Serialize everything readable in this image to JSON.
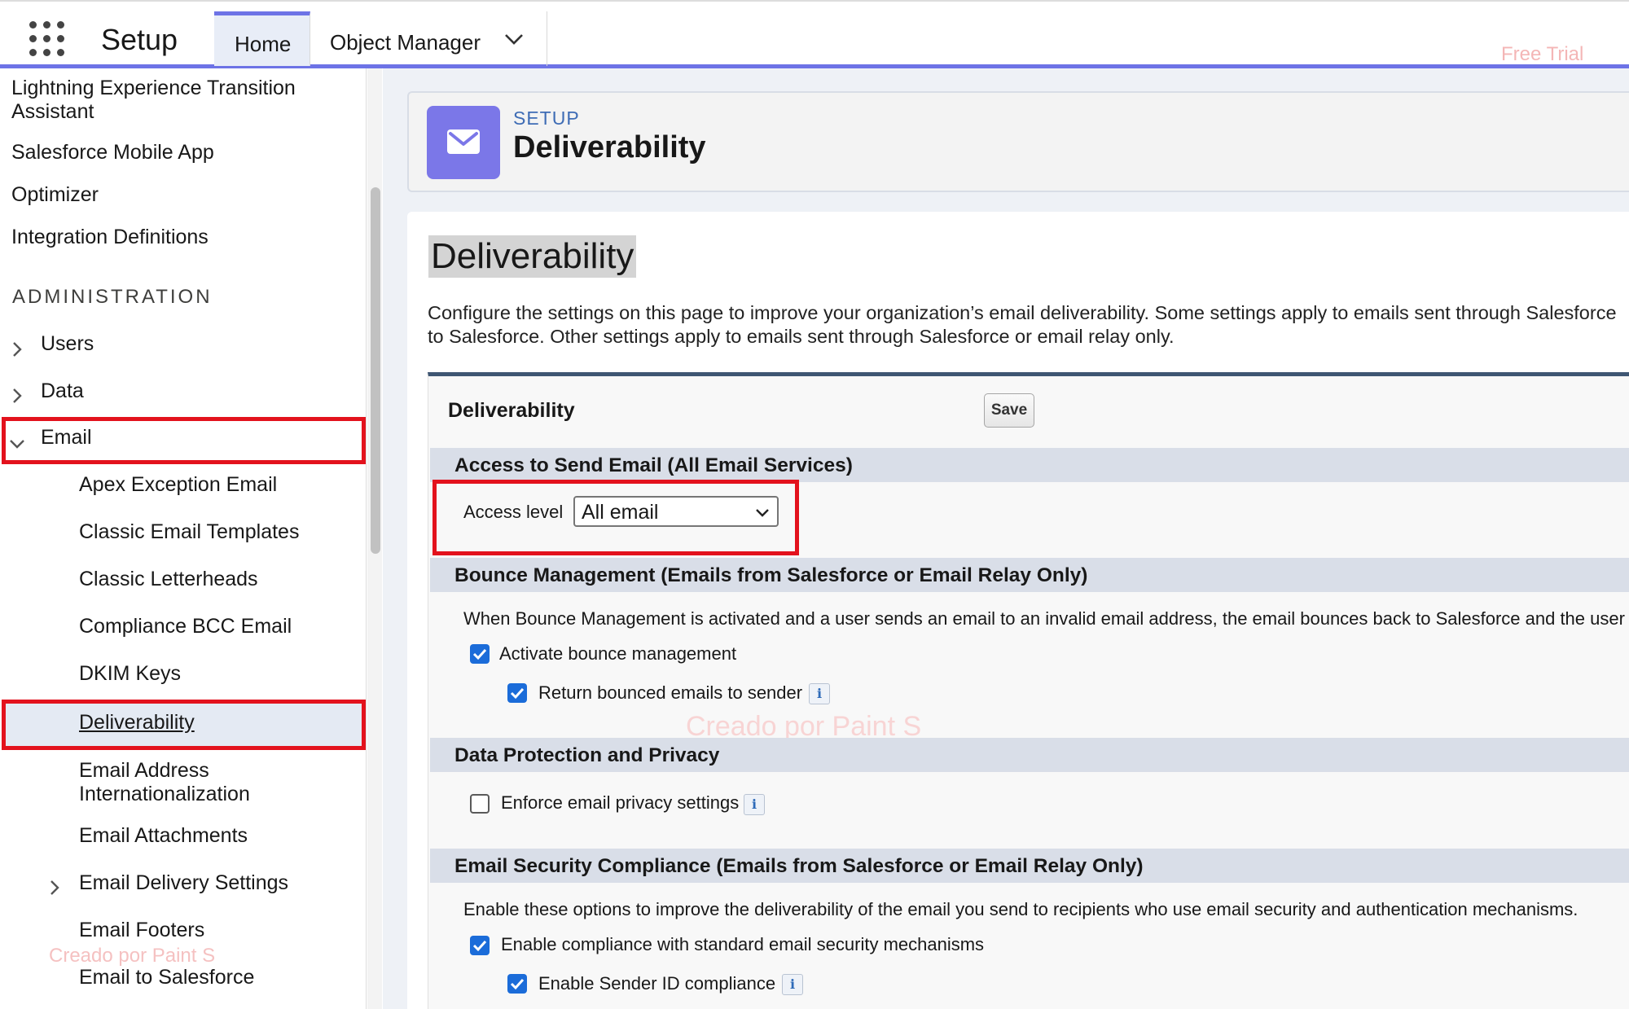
{
  "topbar": {
    "app_title": "Setup",
    "tabs": [
      {
        "label": "Home"
      },
      {
        "label": "Object Manager"
      }
    ],
    "free_trial": "Free Trial"
  },
  "sidebar": {
    "items_top": [
      {
        "label": "Lightning Experience Transition Assistant"
      },
      {
        "label": "Salesforce Mobile App"
      },
      {
        "label": "Optimizer"
      },
      {
        "label": "Integration Definitions"
      }
    ],
    "section_heading": "ADMINISTRATION",
    "groups": [
      {
        "label": "Users"
      },
      {
        "label": "Data"
      },
      {
        "label": "Email"
      }
    ],
    "email_children": [
      {
        "label": "Apex Exception Email"
      },
      {
        "label": "Classic Email Templates"
      },
      {
        "label": "Classic Letterheads"
      },
      {
        "label": "Compliance BCC Email"
      },
      {
        "label": "DKIM Keys"
      },
      {
        "label": "Deliverability"
      },
      {
        "label": "Email Address Internationalization"
      },
      {
        "label": "Email Attachments"
      },
      {
        "label": "Email Delivery Settings"
      },
      {
        "label": "Email Footers"
      },
      {
        "label": "Email to Salesforce"
      }
    ],
    "watermark": "Creado por Paint S"
  },
  "header": {
    "eyebrow": "SETUP",
    "title": "Deliverability"
  },
  "page": {
    "title": "Deliverability",
    "description_line1": "Configure the settings on this page to improve your organization’s email deliverability. Some settings apply to emails sent through Salesforce",
    "description_line2": "to Salesforce. Other settings apply to emails sent through Salesforce or email relay only."
  },
  "panel": {
    "title": "Deliverability",
    "save_label": "Save",
    "access_section": {
      "heading": "Access to Send Email (All Email Services)",
      "access_label": "Access level",
      "access_value": "All email"
    },
    "bounce_section": {
      "heading": "Bounce Management (Emails from Salesforce or Email Relay Only)",
      "description": "When Bounce Management is activated and a user sends an email to an invalid email address, the email bounces back to Salesforce and the user",
      "activate_label": "Activate bounce management",
      "activate_checked": true,
      "return_label": "Return bounced emails to sender",
      "return_checked": true
    },
    "privacy_section": {
      "heading": "Data Protection and Privacy",
      "enforce_label": "Enforce email privacy settings",
      "enforce_checked": false
    },
    "compliance_section": {
      "heading": "Email Security Compliance (Emails from Salesforce or Email Relay Only)",
      "description": "Enable these options to improve the deliverability of the email you send to recipients who use email security and authentication mechanisms.",
      "standard_label": "Enable compliance with standard email security mechanisms",
      "standard_checked": true,
      "sender_id_label": "Enable Sender ID compliance",
      "sender_id_checked": true
    },
    "watermark": "Creado por Paint S"
  },
  "colors": {
    "brand_accent": "#6d73e6",
    "checkbox_blue": "#1b6cd9",
    "highlight_red": "#e3121d",
    "section_bar": "#d9dee8"
  }
}
